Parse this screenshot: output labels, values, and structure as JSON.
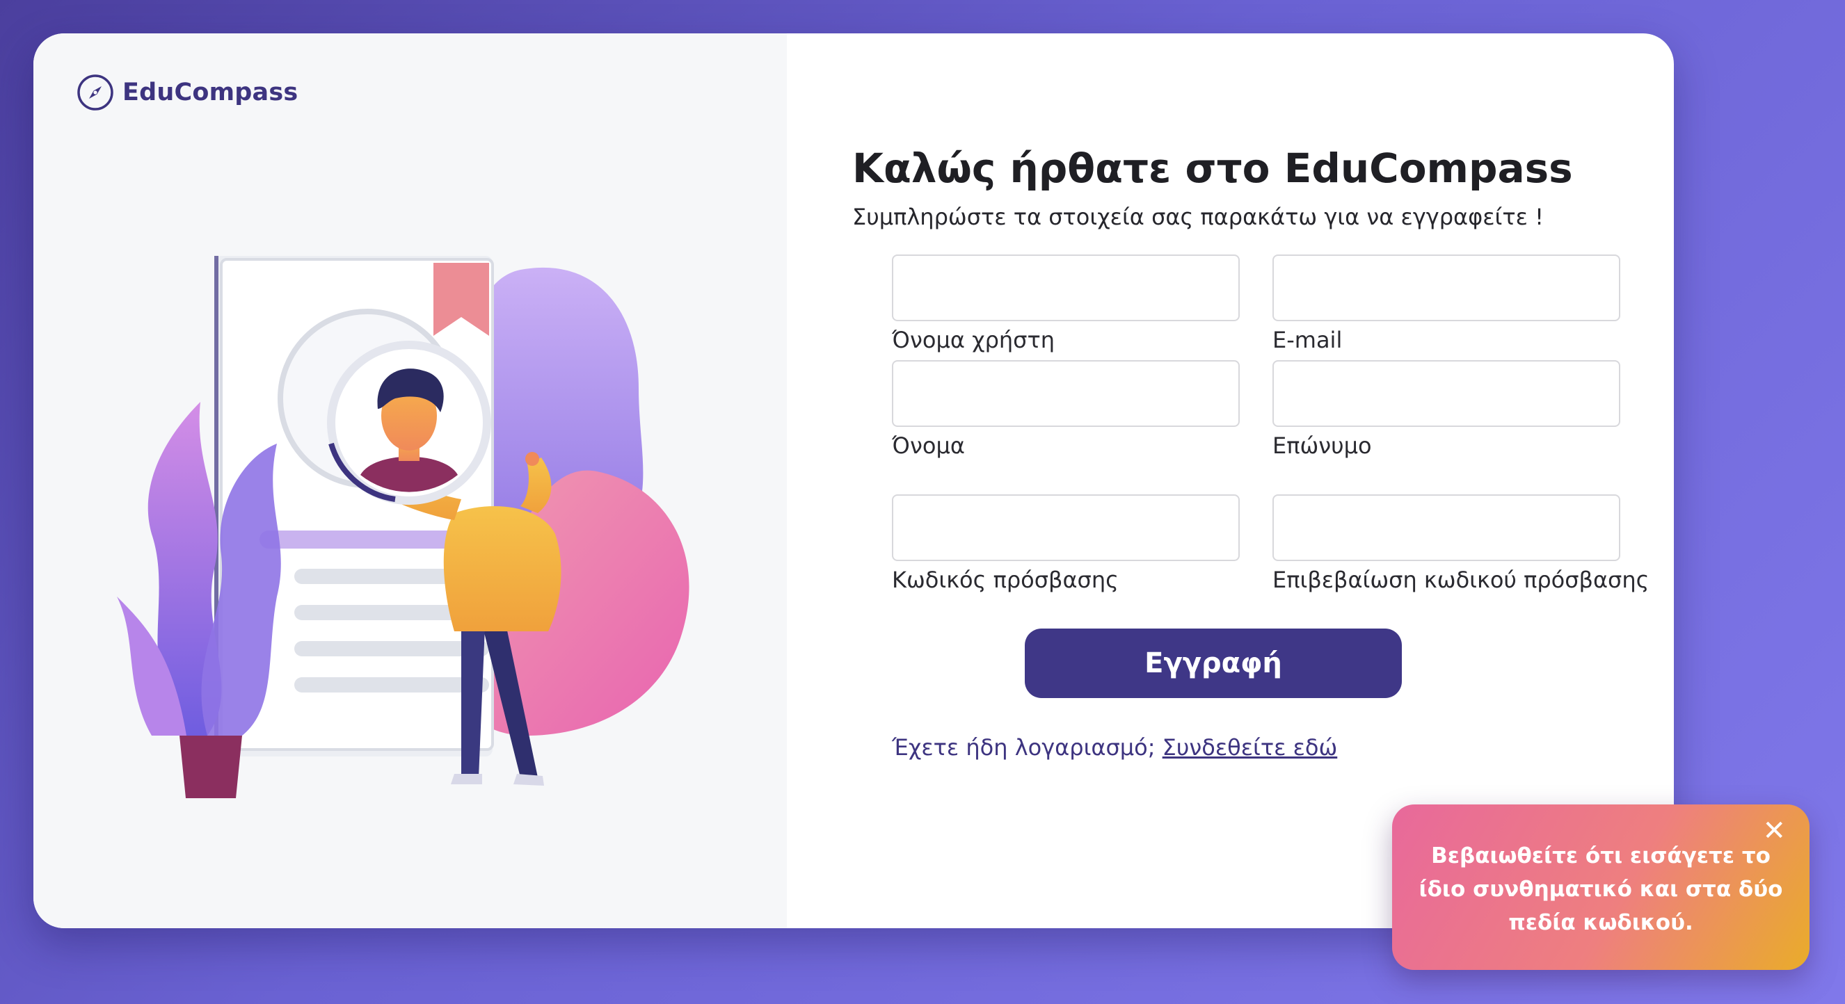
{
  "brand": {
    "name": "EduCompass",
    "logo_icon": "compass-icon"
  },
  "welcome": {
    "title": "Καλώς ήρθατε στο EduCompass",
    "subtitle": "Συμπληρώστε τα στοιχεία σας παρακάτω για να εγγραφείτε !"
  },
  "form": {
    "fields": {
      "username": {
        "label": "Όνομα χρήστη",
        "value": ""
      },
      "email": {
        "label": "E-mail",
        "value": ""
      },
      "first_name": {
        "label": "Όνομα",
        "value": ""
      },
      "last_name": {
        "label": "Επώνυμο",
        "value": ""
      },
      "password": {
        "label": "Κωδικός πρόσβασης",
        "value": ""
      },
      "confirm_password": {
        "label": "Επιβεβαίωση κωδικού πρόσβασης",
        "value": ""
      }
    },
    "submit_label": "Εγγραφή"
  },
  "login_prompt": {
    "text": "Έχετε ήδη λογαριασμό; ",
    "link": "Συνδεθείτε εδώ"
  },
  "toast": {
    "message": "Βεβαιωθείτε ότι εισάγετε το ίδιο συνθηματικό και στα δύο πεδία κωδικού.",
    "close_icon": "close-icon"
  },
  "colors": {
    "brand_primary": "#3f3787",
    "background_gradient_start": "#4b3f9e",
    "background_gradient_end": "#8078ea",
    "toast_gradient_start": "#e8699b",
    "toast_gradient_end": "#e9ac2a"
  }
}
